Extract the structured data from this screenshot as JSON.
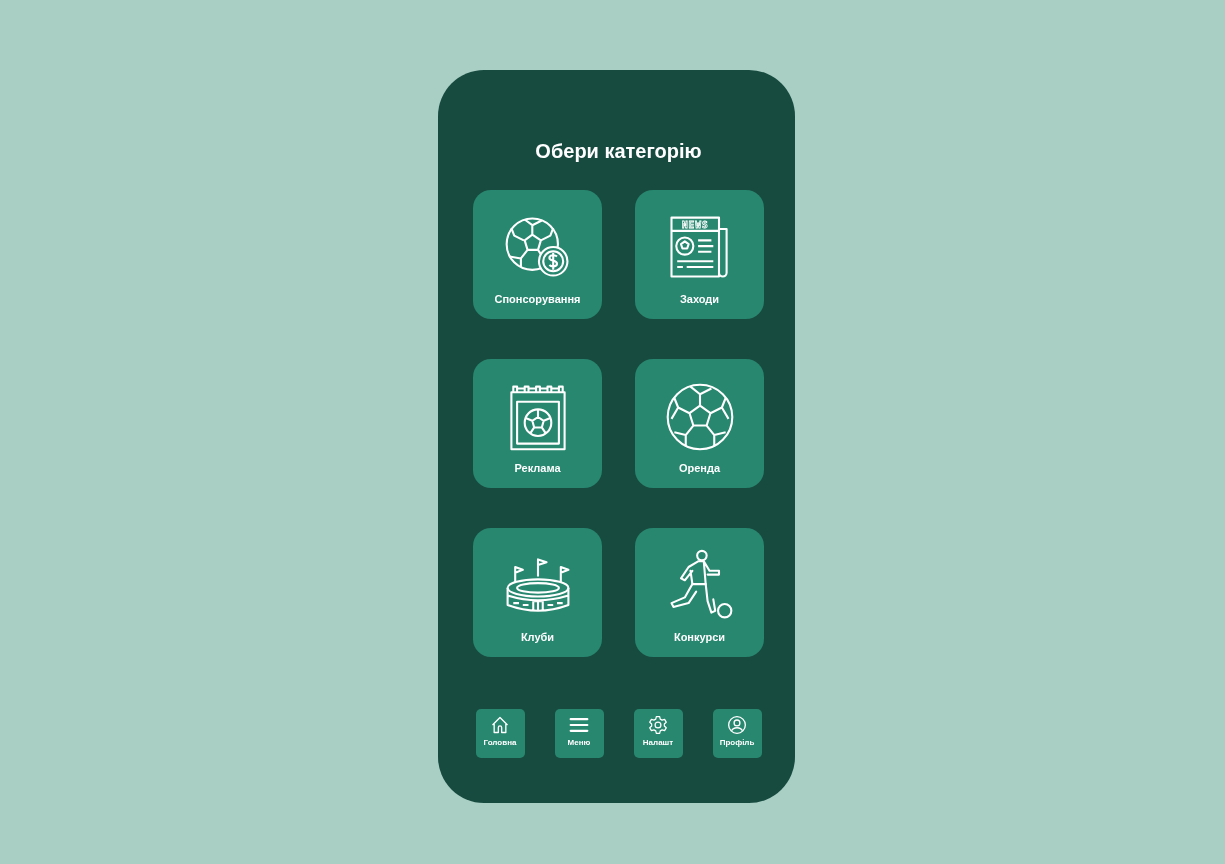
{
  "screen": {
    "title": "Обери категорію"
  },
  "newspaper_icon": {
    "heading": "NEWS"
  },
  "categories": [
    {
      "label": "Спонсорування",
      "kind": "sponsor"
    },
    {
      "label": "Заходи",
      "kind": "news"
    },
    {
      "label": "Реклама",
      "kind": "calendar"
    },
    {
      "label": "Оренда",
      "kind": "ball"
    },
    {
      "label": "Клуби",
      "kind": "stadium"
    },
    {
      "label": "Конкурси",
      "kind": "player"
    }
  ],
  "nav": [
    {
      "label": "Головна",
      "kind": "home"
    },
    {
      "label": "Меню",
      "kind": "menu"
    },
    {
      "label": "Налашт",
      "kind": "settings"
    },
    {
      "label": "Профіль",
      "kind": "profile"
    }
  ]
}
